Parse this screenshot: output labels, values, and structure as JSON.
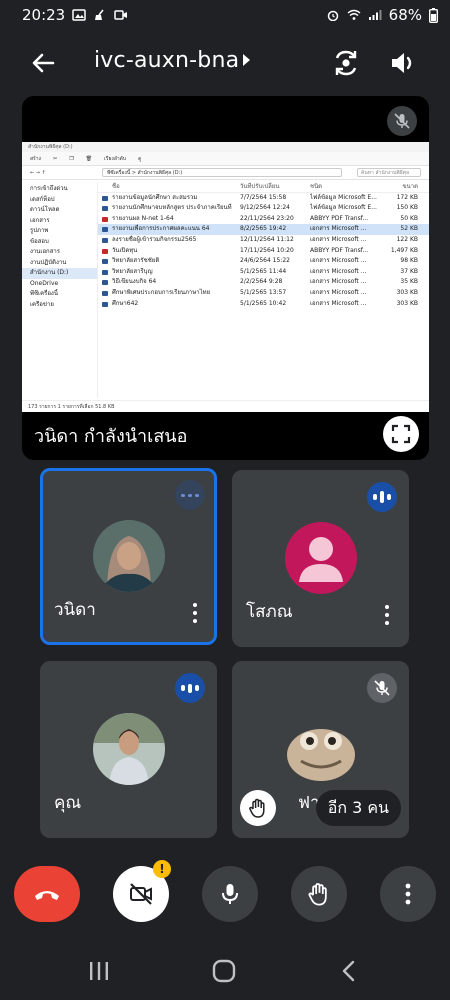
{
  "status_bar": {
    "time": "20:23",
    "battery": "68%"
  },
  "header": {
    "meeting_code": "ivc-auxn-bna"
  },
  "presentation": {
    "presenter_label": "วนิดา กำลังนำเสนอ",
    "explorer": {
      "window_title": "สำนักงานพิธีศุล (D:)",
      "toolbar": [
        "สร้าง",
        "เรียงลำดับ",
        "ดู"
      ],
      "breadcrumb": "พีซีเครื่องนี้ > สำนักงานพิธีศุล (D:)",
      "search_placeholder": "ค้นหา สำนักงานพิธีศุล",
      "nav_items": [
        "การเข้าถึงด่วน",
        "เดสก์ท็อป",
        "ดาวน์โหลด",
        "เอกสาร",
        "รูปภาพ",
        "ข้อสอบ",
        "งานเอกสาร",
        "งานปฏิบัติงาน",
        "สำนักงาน (D:)",
        "OneDrive",
        "พีซีเครื่องนี้",
        "เครือข่าย"
      ],
      "columns": {
        "name": "ชื่อ",
        "date": "วันที่ปรับเปลี่ยน",
        "type": "ชนิด",
        "size": "ขนาด"
      },
      "files": [
        {
          "name": "รายงานข้อมูลนักศึกษา สะสมรวม",
          "date": "7/7/2564 15:58",
          "type": "ไฟล์ข้อมูล Microsoft E...",
          "size": "172 KB"
        },
        {
          "name": "รายงานนักศึกษาจบหลักสูตร ประจำภาคเรียนที่ 1...",
          "date": "9/12/2564 12:24",
          "type": "ไฟล์ข้อมูล Microsoft E...",
          "size": "150 KB"
        },
        {
          "name": "รายงานผล N-net 1-64",
          "date": "22/11/2564 23:20",
          "type": "ABBYY PDF Transf...",
          "size": "50 KB"
        },
        {
          "name": "รายงานเพื่อการประกาศผลคะแนน 64",
          "date": "8/2/2565 19:42",
          "type": "เอกสาร Microsoft ...",
          "size": "52 KB"
        },
        {
          "name": "ลงรายชื่อผู้เข้าร่วมกิจกรรม2565",
          "date": "12/11/2564 11:12",
          "type": "เอกสาร Microsoft ...",
          "size": "122 KB"
        },
        {
          "name": "วันเปิดทุน",
          "date": "17/11/2564 10:20",
          "type": "ABBYY PDF Transf...",
          "size": "1,497 KB"
        },
        {
          "name": "วิทยาลัยสารัชชัยติ",
          "date": "24/6/2564 15:22",
          "type": "เอกสาร Microsoft ...",
          "size": "98 KB"
        },
        {
          "name": "วิทยาลัยสารีบุญ",
          "date": "5/1/2565 11:44",
          "type": "เอกสาร Microsoft ...",
          "size": "37 KB"
        },
        {
          "name": "วิธีเขียนงบกิจ 64",
          "date": "2/2/2564 9:28",
          "type": "เอกสาร Microsoft ...",
          "size": "35 KB"
        },
        {
          "name": "ศึกษาพิเศษประกอบการเรียนภาษาไทย",
          "date": "5/1/2565 13:57",
          "type": "เอกสาร Microsoft ...",
          "size": "303 KB"
        },
        {
          "name": "ศึกษา642",
          "date": "5/1/2565 10:42",
          "type": "เอกสาร Microsoft ...",
          "size": "303 KB"
        }
      ],
      "status_text": "173 รายการ   1 รายการที่เลือก 51.8 KB"
    }
  },
  "participants": [
    {
      "name": "วนิดา",
      "state": "active"
    },
    {
      "name": "โสภณ",
      "state": "speaking"
    },
    {
      "name": "คุณ",
      "state": "speaking"
    },
    {
      "name": "ฟาฮารี",
      "state": "muted"
    }
  ],
  "overflow": {
    "label": "อีก 3 คน"
  },
  "colors": {
    "background": "#202124",
    "tile": "#3c4043",
    "active_border": "#1a73e8",
    "end_call": "#ea4335",
    "avatar_pink": "#c2185b",
    "warning": "#fbbc04"
  }
}
